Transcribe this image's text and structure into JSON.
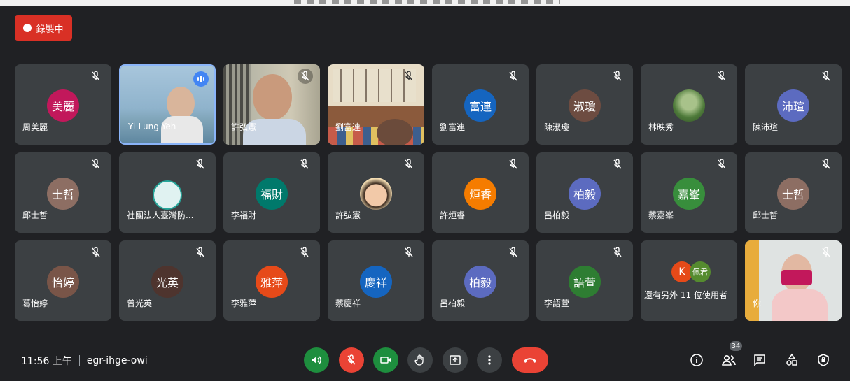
{
  "recording": {
    "label": "錄製中"
  },
  "meeting": {
    "time": "11:56 上午",
    "code": "egr-ihge-owi",
    "participant_count": "34"
  },
  "tiles": [
    {
      "name": "周美麗",
      "initials": "美麗",
      "color": "#c2185b",
      "muted": true
    },
    {
      "name": "Yi-Lung Yeh",
      "initials": "",
      "color": "",
      "muted": false,
      "video": "sea",
      "speaking": true
    },
    {
      "name": "許弘憲",
      "initials": "",
      "color": "",
      "muted": true,
      "video": "office"
    },
    {
      "name": "劉富連",
      "initials": "",
      "color": "",
      "muted": true,
      "video": "calligraphy"
    },
    {
      "name": "劉富連",
      "initials": "富連",
      "color": "#1565c0",
      "muted": true
    },
    {
      "name": "陳淑瓊",
      "initials": "淑瓊",
      "color": "#6d4c41",
      "muted": true
    },
    {
      "name": "林映秀",
      "initials": "",
      "color": "#2e7d32",
      "muted": true,
      "avatar_image": "garden-photo"
    },
    {
      "name": "陳沛瑄",
      "initials": "沛瑄",
      "color": "#5c6bc0",
      "muted": true
    },
    {
      "name": "邱士哲",
      "initials": "士哲",
      "color": "#8d6e63",
      "muted": true
    },
    {
      "name": "社團法人臺灣防...",
      "initials": "",
      "color": "#e0f2f1",
      "muted": true,
      "avatar_image": "organization-logo"
    },
    {
      "name": "李福財",
      "initials": "福財",
      "color": "#00796b",
      "muted": true
    },
    {
      "name": "許弘憲",
      "initials": "",
      "color": "#f5deb3",
      "muted": true,
      "avatar_image": "baby-photo"
    },
    {
      "name": "許烜睿",
      "initials": "烜睿",
      "color": "#f57c00",
      "muted": true
    },
    {
      "name": "呂柏毅",
      "initials": "柏毅",
      "color": "#5c6bc0",
      "muted": true
    },
    {
      "name": "蔡嘉峯",
      "initials": "嘉峯",
      "color": "#388e3c",
      "muted": true
    },
    {
      "name": "邱士哲",
      "initials": "士哲",
      "color": "#8d6e63",
      "muted": true
    },
    {
      "name": "葛怡婷",
      "initials": "怡婷",
      "color": "#795548",
      "muted": true
    },
    {
      "name": "曾光英",
      "initials": "光英",
      "color": "#4e342e",
      "muted": true
    },
    {
      "name": "李雅萍",
      "initials": "雅萍",
      "color": "#e64a19",
      "muted": true
    },
    {
      "name": "蔡慶祥",
      "initials": "慶祥",
      "color": "#1565c0",
      "muted": true
    },
    {
      "name": "呂柏毅",
      "initials": "柏毅",
      "color": "#5c6bc0",
      "muted": true
    },
    {
      "name": "李語萱",
      "initials": "語萱",
      "color": "#2e7d32",
      "muted": true
    }
  ],
  "others": {
    "label": "還有另外 11 位使用者",
    "avatars": [
      {
        "initials": "K",
        "color": "#e64a19"
      },
      {
        "initials": "佩君",
        "color": "#558b2f"
      }
    ]
  },
  "self": {
    "name": "你"
  },
  "controls": {
    "audio_icon": "volume-icon",
    "mic_icon": "mic-off-icon",
    "camera_icon": "camera-icon",
    "hand_icon": "raise-hand-icon",
    "present_icon": "present-icon",
    "more_icon": "more-vert-icon",
    "hangup_icon": "hangup-icon"
  },
  "colors": {
    "accent_green": "#1e8e3e",
    "danger_red": "#ea4335",
    "tile_bg": "#3c4043",
    "speaking_blue": "#4285f4"
  }
}
